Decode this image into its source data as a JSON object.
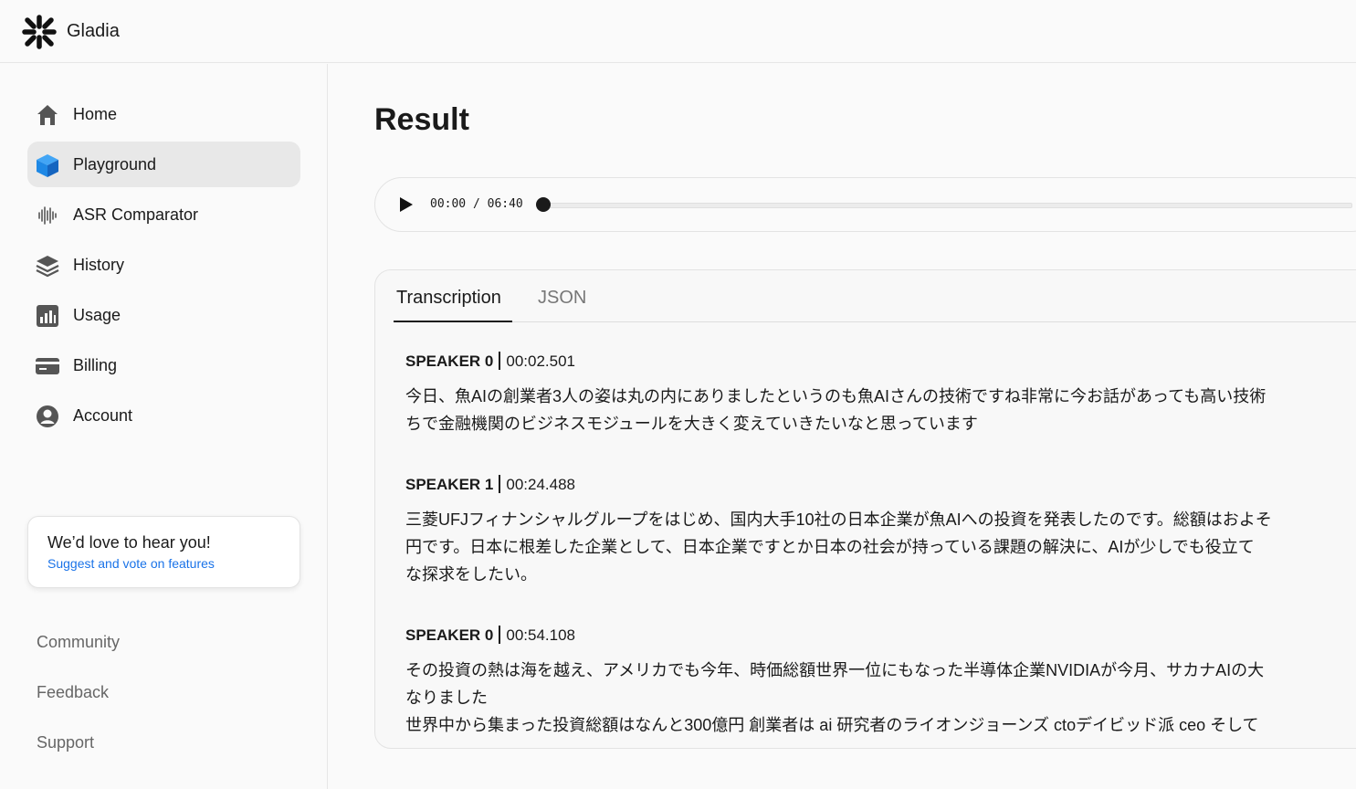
{
  "app": {
    "brand": "Gladia"
  },
  "sidebar": {
    "items": [
      {
        "label": "Home",
        "icon": "home-icon"
      },
      {
        "label": "Playground",
        "icon": "cube-icon",
        "active": true
      },
      {
        "label": "ASR Comparator",
        "icon": "waveform-icon"
      },
      {
        "label": "History",
        "icon": "layers-icon"
      },
      {
        "label": "Usage",
        "icon": "bar-chart-icon"
      },
      {
        "label": "Billing",
        "icon": "credit-card-icon"
      },
      {
        "label": "Account",
        "icon": "user-circle-icon"
      }
    ],
    "feedback": {
      "title": "We’d love to hear you!",
      "link": "Suggest and vote on features"
    },
    "footer_links": [
      "Community",
      "Feedback",
      "Support"
    ]
  },
  "main": {
    "title": "Result",
    "player": {
      "current": "00:00",
      "separator": "/",
      "duration": "06:40",
      "progress": 0
    },
    "tabs": [
      {
        "label": "Transcription",
        "active": true
      },
      {
        "label": "JSON",
        "active": false
      }
    ],
    "segments": [
      {
        "speaker": "SPEAKER 0",
        "time": "00:02.501",
        "text": "今日、魚AIの創業者3人の姿は丸の内にありましたというのも魚AIさんの技術ですね非常に今お話があっても高い技術\nちで金融機関のビジネスモジュールを大きく変えていきたいなと思っています"
      },
      {
        "speaker": "SPEAKER 1",
        "time": "00:24.488",
        "text": "三菱UFJフィナンシャルグループをはじめ、国内大手10社の日本企業が魚AIへの投資を発表したのです。総額はおよそ\n円です。日本に根差した企業として、日本企業ですとか日本の社会が持っている課題の解決に、AIが少しでも役立て\nな探求をしたい。"
      },
      {
        "speaker": "SPEAKER 0",
        "time": "00:54.108",
        "text": "その投資の熱は海を越え、アメリカでも今年、時価総額世界一位にもなった半導体企業NVIDIAが今月、サカナAIの大\nなりました\n世界中から集まった投資総額はなんと300億円 創業者は ai 研究者のライオンジョーンズ ctoデイビッド派 ceo そして"
      }
    ]
  },
  "colors": {
    "accent_blue": "#1a73e8",
    "active_nav_bg": "#e8e8e8",
    "cube_blue": "#1e88e5"
  }
}
